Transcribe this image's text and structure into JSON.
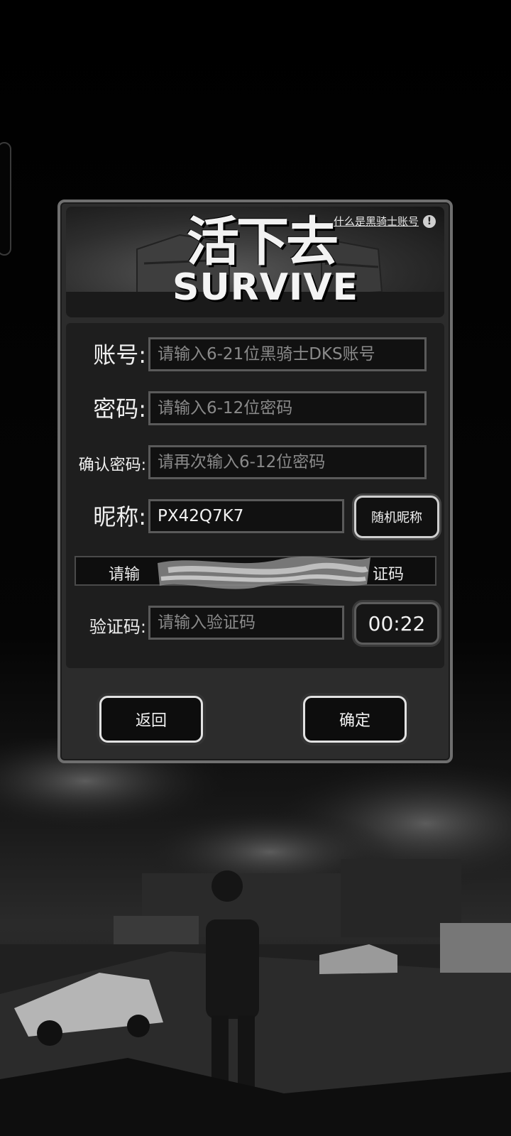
{
  "banner": {
    "title_cn": "活下去",
    "title_en": "SURVIVE",
    "help_link": "什么是黑骑士账号",
    "help_icon": "!"
  },
  "form": {
    "account": {
      "label": "账号:",
      "placeholder": "请输入6-21位黑骑士DKS账号"
    },
    "password": {
      "label": "密码:",
      "placeholder": "请输入6-12位密码"
    },
    "confirm_password": {
      "label": "确认密码:",
      "placeholder": "请再次输入6-12位密码"
    },
    "nickname": {
      "label": "昵称:",
      "value": "PX42Q7K7",
      "random_button": "随机昵称"
    },
    "notice": {
      "left_text": "请输",
      "right_text": "证码"
    },
    "verification": {
      "label": "验证码:",
      "placeholder": "请输入验证码",
      "countdown": "00:22"
    }
  },
  "actions": {
    "back": "返回",
    "confirm": "确定"
  },
  "icons": [
    "exclamation-circle-icon"
  ],
  "colors": {
    "panel": "#2c2c2c",
    "border": "#6f6f6f",
    "field_bg": "#111111"
  }
}
